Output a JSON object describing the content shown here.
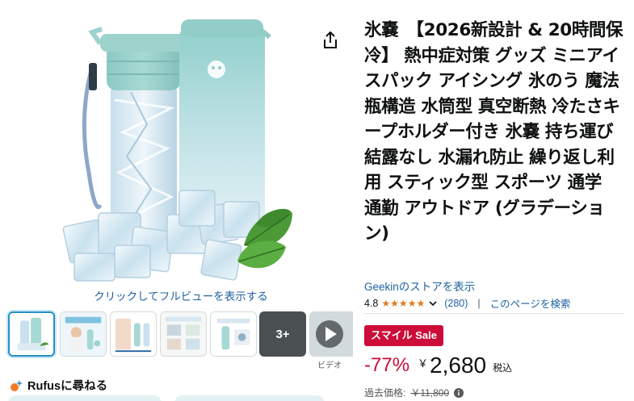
{
  "gallery": {
    "fullview_link": "クリックしてフルビューを表示する",
    "more_count": "3+",
    "video_label": "ビデオ",
    "share_icon": "share-icon"
  },
  "rufus": {
    "label": "Rufusに尋ねる",
    "icon": "rufus-sparkle-icon"
  },
  "product": {
    "title": "氷嚢　【2026新設計 & 20時間保冷】 熱中症対策 グッズ ミニアイスパック アイシング 氷のう 魔法瓶構造 水筒型 真空断熱 冷たさキープホルダー付き 氷嚢 持ち運び 結露なし 水漏れ防止 繰り返し利用 スティック型 スポーツ 通学 通勤 アウトドア (グラデーション)",
    "store_link": "Geekinのストアを表示",
    "rating": "4.8",
    "stars": 4.8,
    "rating_count": "(280)",
    "separator": "|",
    "search_page": "このページを検索"
  },
  "pricing": {
    "sale_badge": "スマイル Sale",
    "discount": "-77%",
    "currency": "￥",
    "price": "2,680",
    "tax_label": "税込",
    "list_price_label": "過去価格:",
    "list_price": "￥11,800"
  },
  "colors": {
    "link": "#2162a1",
    "sale": "#cc0c39",
    "star": "#de7921",
    "bottle_top": "#9fd3cf"
  }
}
